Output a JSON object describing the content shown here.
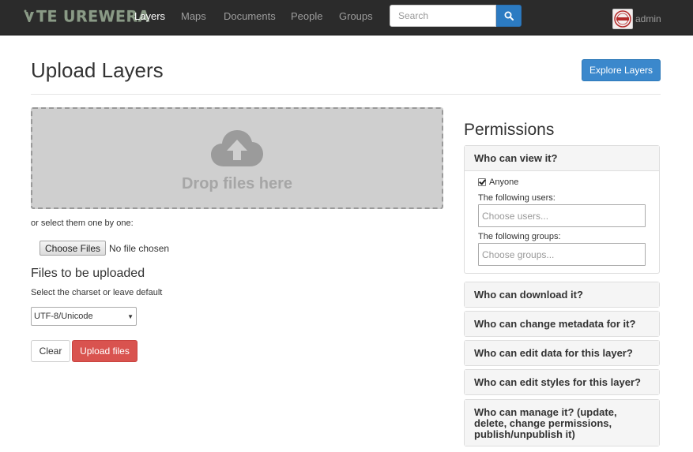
{
  "navbar": {
    "brand": "TE UREWERA",
    "links": [
      "Layers",
      "Maps",
      "Documents",
      "People",
      "Groups"
    ],
    "active": "Layers",
    "search_placeholder": "Search",
    "username": "admin"
  },
  "page": {
    "title": "Upload Layers",
    "explore_button": "Explore Layers"
  },
  "upload": {
    "drop_text": "Drop files here",
    "select_one": "or select them one by one:",
    "choose_button": "Choose Files",
    "no_file": "No file chosen",
    "files_heading": "Files to be uploaded",
    "charset_help": "Select the charset or leave default",
    "charset_value": "UTF-8/Unicode",
    "clear_button": "Clear",
    "upload_button": "Upload files"
  },
  "permissions": {
    "heading": "Permissions",
    "view": {
      "title": "Who can view it?",
      "anyone_label": "Anyone",
      "anyone_checked": true,
      "users_label": "The following users:",
      "users_placeholder": "Choose users...",
      "groups_label": "The following groups:",
      "groups_placeholder": "Choose groups..."
    },
    "other_panels": [
      "Who can download it?",
      "Who can change metadata for it?",
      "Who can edit data for this layer?",
      "Who can edit styles for this layer?",
      "Who can manage it? (update, delete, change permissions, publish/unpublish it)"
    ]
  },
  "colors": {
    "navbar_bg": "#2b2b2b",
    "primary": "#3b88cc",
    "danger": "#d9534f",
    "dropzone_bg": "#cfcfcf"
  },
  "icons": {
    "search": "magnifier-icon",
    "upload": "cloud-upload-icon",
    "brand": "logo-icon",
    "avatar": "stamp-avatar"
  }
}
